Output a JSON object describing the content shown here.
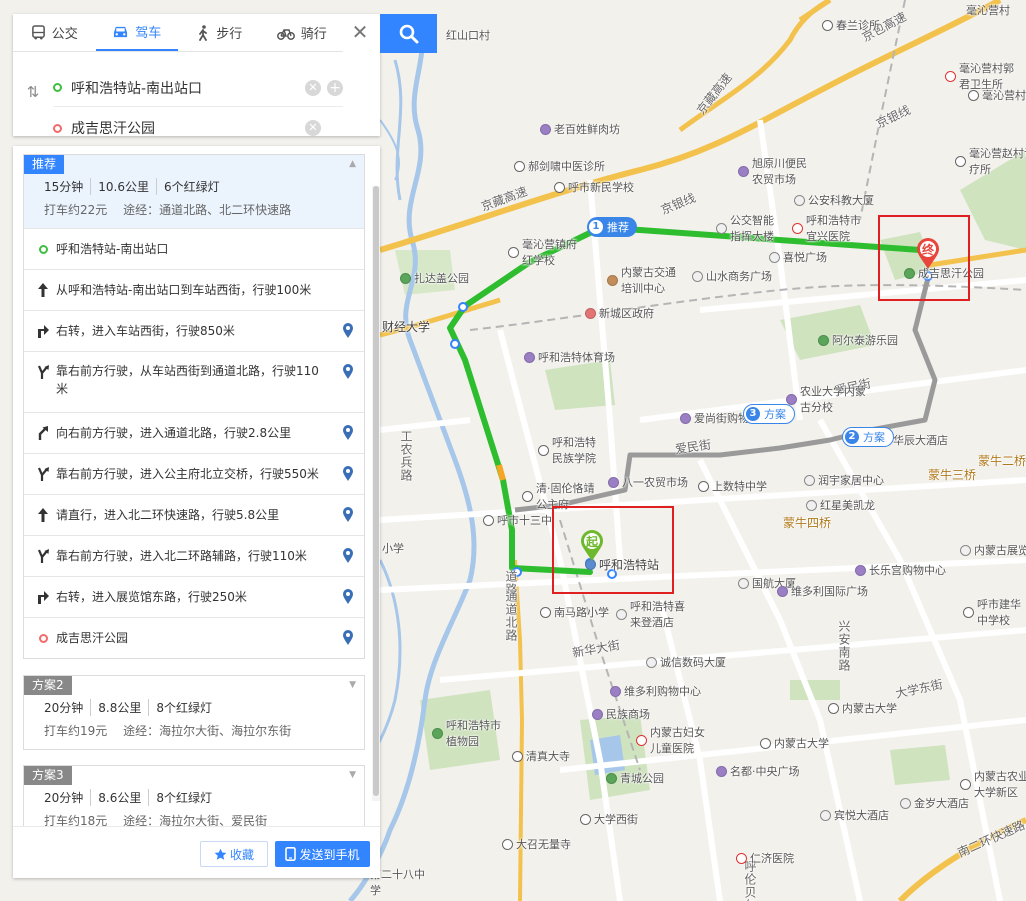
{
  "tabs": [
    {
      "label": "公交",
      "icon": "bus-icon"
    },
    {
      "label": "驾车",
      "icon": "car-icon"
    },
    {
      "label": "步行",
      "icon": "walk-icon"
    },
    {
      "label": "骑行",
      "icon": "bike-icon"
    }
  ],
  "active_tab": "驾车",
  "route": {
    "start": "呼和浩特站-南出站口",
    "end": "成吉思汗公园"
  },
  "plans": {
    "recommended": {
      "tag": "推荐",
      "time": "15分钟",
      "distance": "10.6公里",
      "lights": "6个红绿灯",
      "taxi": "打车约22元",
      "via": "途经：通道北路、北二环快速路",
      "steps": [
        {
          "type": "start",
          "text": "呼和浩特站-南出站口"
        },
        {
          "type": "straight",
          "text": "从呼和浩特站-南出站口到车站西街，行驶100米"
        },
        {
          "type": "right",
          "text": "右转，进入车站西街，行驶850米"
        },
        {
          "type": "keep-right",
          "text": "靠右前方行驶，从车站西街到通道北路，行驶110米"
        },
        {
          "type": "slight-right",
          "text": "向右前方行驶，进入通道北路，行驶2.8公里"
        },
        {
          "type": "keep-right",
          "text": "靠右前方行驶，进入公主府北立交桥，行驶550米"
        },
        {
          "type": "straight",
          "text": "请直行，进入北二环快速路，行驶5.8公里"
        },
        {
          "type": "keep-right",
          "text": "靠右前方行驶，进入北二环路辅路，行驶110米"
        },
        {
          "type": "right",
          "text": "右转，进入展览馆东路，行驶250米"
        },
        {
          "type": "end",
          "text": "成吉思汗公园"
        }
      ]
    },
    "plan2": {
      "tag": "方案2",
      "time": "20分钟",
      "distance": "8.8公里",
      "lights": "8个红绿灯",
      "taxi": "打车约19元",
      "via": "途经：海拉尔大街、海拉尔东街"
    },
    "plan3": {
      "tag": "方案3",
      "time": "20分钟",
      "distance": "8.6公里",
      "lights": "8个红绿灯",
      "taxi": "打车约18元",
      "via": "途经：海拉尔大街、爱民街"
    }
  },
  "footer": {
    "favorite": "收藏",
    "send": "发送到手机"
  },
  "map": {
    "route_labels": [
      {
        "num": "1",
        "text": "推荐"
      },
      {
        "num": "3",
        "text": "方案"
      },
      {
        "num": "2",
        "text": "方案"
      }
    ],
    "start_marker": "起",
    "end_marker": "终",
    "roads": [
      "京包高速",
      "京藏高速",
      "京银线",
      "京银线",
      "京藏高速",
      "工农兵路",
      "爱民街",
      "爱民街",
      "新华大街",
      "大学东街",
      "兴安南路",
      "南二环快速路",
      "道路",
      "通道北路",
      "呼伦贝尔"
    ],
    "districts": [
      "蒙牛二桥",
      "蒙牛三桥",
      "蒙牛四桥"
    ],
    "pois": [
      {
        "name": "红山口村",
        "kind": "none"
      },
      {
        "name": "春兰诊所",
        "kind": "bus"
      },
      {
        "name": "毫沁营村",
        "kind": "none"
      },
      {
        "name": "毫沁营村郭君卫生所",
        "kind": "hosp"
      },
      {
        "name": "毫沁营村",
        "kind": "bus"
      },
      {
        "name": "毫沁营赵村诊疗所",
        "kind": "bus"
      },
      {
        "name": "老百姓鲜肉坊",
        "kind": "shop"
      },
      {
        "name": "郝剑啸中医诊所",
        "kind": "bus"
      },
      {
        "name": "呼市新民学校",
        "kind": "bus"
      },
      {
        "name": "旭原川便民农贸市场",
        "kind": "shop"
      },
      {
        "name": "公安科教大厦",
        "kind": "bank"
      },
      {
        "name": "呼和浩特市宜兴医院",
        "kind": "hosp"
      },
      {
        "name": "毫沁营镇府红学校",
        "kind": "bus"
      },
      {
        "name": "公交智能指挥大楼",
        "kind": "bank"
      },
      {
        "name": "喜悦广场",
        "kind": "bank"
      },
      {
        "name": "扎达盖公园",
        "kind": "park"
      },
      {
        "name": "内蒙古交通培训中心",
        "kind": "edu"
      },
      {
        "name": "山水商务广场",
        "kind": "bank"
      },
      {
        "name": "成吉思汗公园",
        "kind": "park"
      },
      {
        "name": "新城区政府",
        "kind": "gov"
      },
      {
        "name": "财经大学",
        "kind": "none"
      },
      {
        "name": "呼和浩特体育场",
        "kind": "shop"
      },
      {
        "name": "阿尔泰游乐园",
        "kind": "park"
      },
      {
        "name": "农业大学内蒙古分校",
        "kind": "shop"
      },
      {
        "name": "爱尚街购物",
        "kind": "shop"
      },
      {
        "name": "华辰大酒店",
        "kind": "none"
      },
      {
        "name": "呼和浩特民族学院",
        "kind": "bus"
      },
      {
        "name": "八一农贸市场",
        "kind": "shop"
      },
      {
        "name": "上数特中学",
        "kind": "bus"
      },
      {
        "name": "润宇家居中心",
        "kind": "bank"
      },
      {
        "name": "清·固伦恪靖公主府",
        "kind": "bus"
      },
      {
        "name": "红星美凯龙",
        "kind": "bank"
      },
      {
        "name": "呼市十三中",
        "kind": "bus"
      },
      {
        "name": "呼和浩特站",
        "kind": "stn"
      },
      {
        "name": "国航大厦",
        "kind": "bank"
      },
      {
        "name": "内蒙古展览馆",
        "kind": "bank"
      },
      {
        "name": "长乐宫购物中心",
        "kind": "shop"
      },
      {
        "name": "维多利国际广场",
        "kind": "shop"
      },
      {
        "name": "南马路小学",
        "kind": "bus"
      },
      {
        "name": "呼和浩特喜来登酒店",
        "kind": "bank"
      },
      {
        "name": "呼市建华中学校",
        "kind": "bus"
      },
      {
        "name": "诚信数码大厦",
        "kind": "bank"
      },
      {
        "name": "维多利购物中心",
        "kind": "shop"
      },
      {
        "name": "民族商场",
        "kind": "shop"
      },
      {
        "name": "内蒙古大学",
        "kind": "bus"
      },
      {
        "name": "呼和浩特市植物园",
        "kind": "park"
      },
      {
        "name": "内蒙古妇女儿童医院",
        "kind": "hosp"
      },
      {
        "name": "内蒙古大学",
        "kind": "bus"
      },
      {
        "name": "清真大寺",
        "kind": "bus"
      },
      {
        "name": "青城公园",
        "kind": "park"
      },
      {
        "name": "名都·中央广场",
        "kind": "shop"
      },
      {
        "name": "内蒙古农业大学新区",
        "kind": "bus"
      },
      {
        "name": "宾悦大酒店",
        "kind": "bank"
      },
      {
        "name": "金岁大酒店",
        "kind": "bank"
      },
      {
        "name": "大学西街",
        "kind": "bus"
      },
      {
        "name": "大召无量寺",
        "kind": "bus"
      },
      {
        "name": "仁济医院",
        "kind": "hosp"
      },
      {
        "name": "第二十八中学",
        "kind": "none"
      },
      {
        "name": "小学",
        "kind": "none"
      }
    ]
  },
  "colors": {
    "accent": "#3385ff",
    "route_main": "#2ebd2e",
    "route_alt": "#9a9a9a",
    "highlight_box": "#e02020",
    "start_green": "#6db82c",
    "end_red": "#e8453c"
  }
}
